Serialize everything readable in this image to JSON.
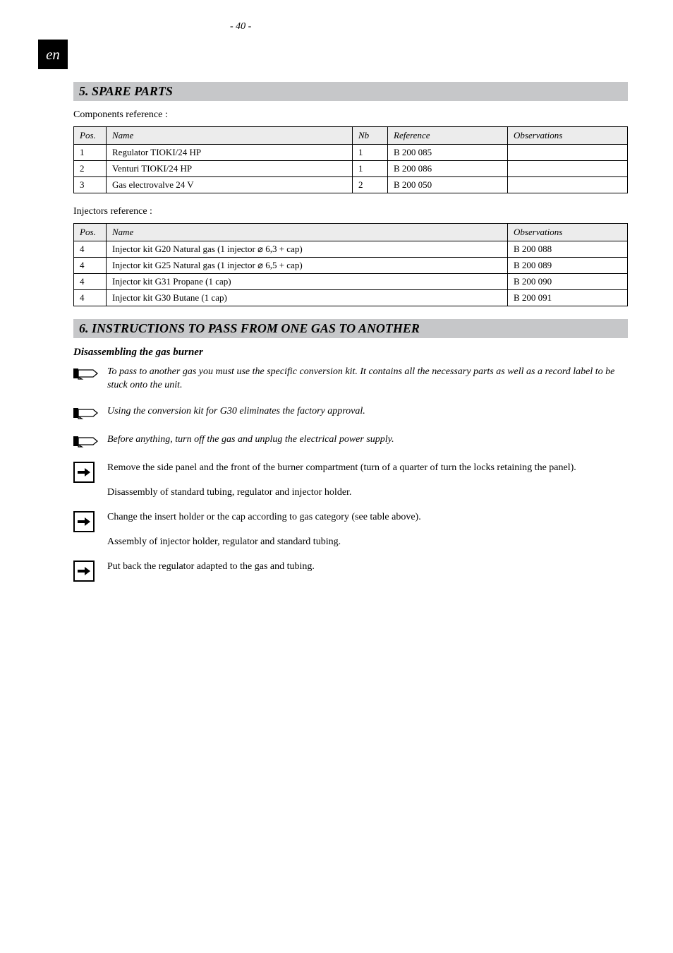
{
  "page_header": {
    "tab": "en",
    "page_number": "- 40 -"
  },
  "sections": {
    "spare_parts": {
      "title": "5. SPARE PARTS",
      "components_intro": "Components reference :",
      "components_table": {
        "headers": {
          "pos": "Pos.",
          "name": "Name",
          "nb": "Nb",
          "ref": "Reference",
          "obs": "Observations"
        },
        "rows": [
          {
            "pos": "1",
            "name": "Regulator TIOKI/24 HP",
            "nb": "1",
            "ref": "B 200 085",
            "obs": ""
          },
          {
            "pos": "2",
            "name": "Venturi TIOKI/24 HP",
            "nb": "1",
            "ref": "B 200 086",
            "obs": ""
          },
          {
            "pos": "3",
            "name": "Gas electrovalve 24 V",
            "nb": "2",
            "ref": "B 200 050",
            "obs": ""
          }
        ]
      },
      "injectors_intro": "Injectors reference :",
      "injectors_table": {
        "headers": {
          "pos": "Pos.",
          "name": "Name",
          "obs": "Observations"
        },
        "rows": [
          {
            "pos": "4",
            "name": "Injector kit G20 Natural gas (1 injector ⌀ 6,3 + cap)",
            "obs": "B 200 088"
          },
          {
            "pos": "4",
            "name": "Injector kit G25 Natural gas (1 injector ⌀ 6,5 + cap)",
            "obs": "B 200 089"
          },
          {
            "pos": "4",
            "name": "Injector kit G31 Propane (1 cap)",
            "obs": "B 200 090"
          },
          {
            "pos": "4",
            "name": "Injector kit G30 Butane (1 cap)",
            "obs": "B 200 091"
          }
        ]
      }
    },
    "instructions": {
      "title": "6. INSTRUCTIONS TO PASS FROM ONE GAS TO ANOTHER",
      "heading": "Disassembling the gas burner",
      "notes": [
        "To pass to another gas you must use the specific conversion kit. It contains all the necessary parts as well as a record label to be stuck onto the unit.",
        "Using the conversion kit for G30 eliminates the factory approval.",
        "Before anything, turn off the gas and unplug the electrical power supply."
      ],
      "steps": [
        {
          "text": "Remove the side panel and the front of the burner compartment (turn of a quarter of turn the locks retaining the panel).",
          "sub": "Disassembly of standard tubing, regulator and injector holder."
        },
        {
          "text": "Change the insert holder or the cap according to gas category (see table above).",
          "sub": "Assembly of injector holder, regulator and standard tubing."
        },
        {
          "text": "Put back the regulator adapted to the gas and tubing.",
          "sub": ""
        }
      ]
    }
  }
}
